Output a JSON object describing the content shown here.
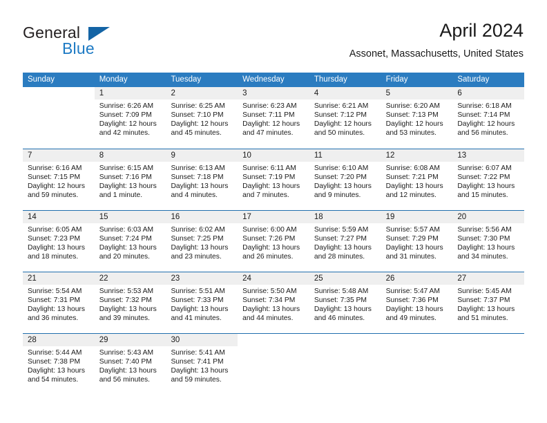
{
  "brand": {
    "name_top": "General",
    "name_bottom": "Blue",
    "accent_color": "#1464a5",
    "blue_text_color": "#1d7ac4",
    "flag_icon": "triangle-flag-icon"
  },
  "header": {
    "title": "April 2024",
    "subtitle": "Assonet, Massachusetts, United States"
  },
  "calendar": {
    "header_bg": "#2b7cc0",
    "header_text_color": "#ffffff",
    "daynum_band_bg": "#efefef",
    "row_divider_color": "#1f6ead",
    "weekday_headers": [
      "Sunday",
      "Monday",
      "Tuesday",
      "Wednesday",
      "Thursday",
      "Friday",
      "Saturday"
    ],
    "weeks": [
      [
        {
          "day": "",
          "sunrise": "",
          "sunset": "",
          "daylight_line1": "",
          "daylight_line2": ""
        },
        {
          "day": "1",
          "sunrise": "Sunrise: 6:26 AM",
          "sunset": "Sunset: 7:09 PM",
          "daylight_line1": "Daylight: 12 hours",
          "daylight_line2": "and 42 minutes."
        },
        {
          "day": "2",
          "sunrise": "Sunrise: 6:25 AM",
          "sunset": "Sunset: 7:10 PM",
          "daylight_line1": "Daylight: 12 hours",
          "daylight_line2": "and 45 minutes."
        },
        {
          "day": "3",
          "sunrise": "Sunrise: 6:23 AM",
          "sunset": "Sunset: 7:11 PM",
          "daylight_line1": "Daylight: 12 hours",
          "daylight_line2": "and 47 minutes."
        },
        {
          "day": "4",
          "sunrise": "Sunrise: 6:21 AM",
          "sunset": "Sunset: 7:12 PM",
          "daylight_line1": "Daylight: 12 hours",
          "daylight_line2": "and 50 minutes."
        },
        {
          "day": "5",
          "sunrise": "Sunrise: 6:20 AM",
          "sunset": "Sunset: 7:13 PM",
          "daylight_line1": "Daylight: 12 hours",
          "daylight_line2": "and 53 minutes."
        },
        {
          "day": "6",
          "sunrise": "Sunrise: 6:18 AM",
          "sunset": "Sunset: 7:14 PM",
          "daylight_line1": "Daylight: 12 hours",
          "daylight_line2": "and 56 minutes."
        }
      ],
      [
        {
          "day": "7",
          "sunrise": "Sunrise: 6:16 AM",
          "sunset": "Sunset: 7:15 PM",
          "daylight_line1": "Daylight: 12 hours",
          "daylight_line2": "and 59 minutes."
        },
        {
          "day": "8",
          "sunrise": "Sunrise: 6:15 AM",
          "sunset": "Sunset: 7:16 PM",
          "daylight_line1": "Daylight: 13 hours",
          "daylight_line2": "and 1 minute."
        },
        {
          "day": "9",
          "sunrise": "Sunrise: 6:13 AM",
          "sunset": "Sunset: 7:18 PM",
          "daylight_line1": "Daylight: 13 hours",
          "daylight_line2": "and 4 minutes."
        },
        {
          "day": "10",
          "sunrise": "Sunrise: 6:11 AM",
          "sunset": "Sunset: 7:19 PM",
          "daylight_line1": "Daylight: 13 hours",
          "daylight_line2": "and 7 minutes."
        },
        {
          "day": "11",
          "sunrise": "Sunrise: 6:10 AM",
          "sunset": "Sunset: 7:20 PM",
          "daylight_line1": "Daylight: 13 hours",
          "daylight_line2": "and 9 minutes."
        },
        {
          "day": "12",
          "sunrise": "Sunrise: 6:08 AM",
          "sunset": "Sunset: 7:21 PM",
          "daylight_line1": "Daylight: 13 hours",
          "daylight_line2": "and 12 minutes."
        },
        {
          "day": "13",
          "sunrise": "Sunrise: 6:07 AM",
          "sunset": "Sunset: 7:22 PM",
          "daylight_line1": "Daylight: 13 hours",
          "daylight_line2": "and 15 minutes."
        }
      ],
      [
        {
          "day": "14",
          "sunrise": "Sunrise: 6:05 AM",
          "sunset": "Sunset: 7:23 PM",
          "daylight_line1": "Daylight: 13 hours",
          "daylight_line2": "and 18 minutes."
        },
        {
          "day": "15",
          "sunrise": "Sunrise: 6:03 AM",
          "sunset": "Sunset: 7:24 PM",
          "daylight_line1": "Daylight: 13 hours",
          "daylight_line2": "and 20 minutes."
        },
        {
          "day": "16",
          "sunrise": "Sunrise: 6:02 AM",
          "sunset": "Sunset: 7:25 PM",
          "daylight_line1": "Daylight: 13 hours",
          "daylight_line2": "and 23 minutes."
        },
        {
          "day": "17",
          "sunrise": "Sunrise: 6:00 AM",
          "sunset": "Sunset: 7:26 PM",
          "daylight_line1": "Daylight: 13 hours",
          "daylight_line2": "and 26 minutes."
        },
        {
          "day": "18",
          "sunrise": "Sunrise: 5:59 AM",
          "sunset": "Sunset: 7:27 PM",
          "daylight_line1": "Daylight: 13 hours",
          "daylight_line2": "and 28 minutes."
        },
        {
          "day": "19",
          "sunrise": "Sunrise: 5:57 AM",
          "sunset": "Sunset: 7:29 PM",
          "daylight_line1": "Daylight: 13 hours",
          "daylight_line2": "and 31 minutes."
        },
        {
          "day": "20",
          "sunrise": "Sunrise: 5:56 AM",
          "sunset": "Sunset: 7:30 PM",
          "daylight_line1": "Daylight: 13 hours",
          "daylight_line2": "and 34 minutes."
        }
      ],
      [
        {
          "day": "21",
          "sunrise": "Sunrise: 5:54 AM",
          "sunset": "Sunset: 7:31 PM",
          "daylight_line1": "Daylight: 13 hours",
          "daylight_line2": "and 36 minutes."
        },
        {
          "day": "22",
          "sunrise": "Sunrise: 5:53 AM",
          "sunset": "Sunset: 7:32 PM",
          "daylight_line1": "Daylight: 13 hours",
          "daylight_line2": "and 39 minutes."
        },
        {
          "day": "23",
          "sunrise": "Sunrise: 5:51 AM",
          "sunset": "Sunset: 7:33 PM",
          "daylight_line1": "Daylight: 13 hours",
          "daylight_line2": "and 41 minutes."
        },
        {
          "day": "24",
          "sunrise": "Sunrise: 5:50 AM",
          "sunset": "Sunset: 7:34 PM",
          "daylight_line1": "Daylight: 13 hours",
          "daylight_line2": "and 44 minutes."
        },
        {
          "day": "25",
          "sunrise": "Sunrise: 5:48 AM",
          "sunset": "Sunset: 7:35 PM",
          "daylight_line1": "Daylight: 13 hours",
          "daylight_line2": "and 46 minutes."
        },
        {
          "day": "26",
          "sunrise": "Sunrise: 5:47 AM",
          "sunset": "Sunset: 7:36 PM",
          "daylight_line1": "Daylight: 13 hours",
          "daylight_line2": "and 49 minutes."
        },
        {
          "day": "27",
          "sunrise": "Sunrise: 5:45 AM",
          "sunset": "Sunset: 7:37 PM",
          "daylight_line1": "Daylight: 13 hours",
          "daylight_line2": "and 51 minutes."
        }
      ],
      [
        {
          "day": "28",
          "sunrise": "Sunrise: 5:44 AM",
          "sunset": "Sunset: 7:38 PM",
          "daylight_line1": "Daylight: 13 hours",
          "daylight_line2": "and 54 minutes."
        },
        {
          "day": "29",
          "sunrise": "Sunrise: 5:43 AM",
          "sunset": "Sunset: 7:40 PM",
          "daylight_line1": "Daylight: 13 hours",
          "daylight_line2": "and 56 minutes."
        },
        {
          "day": "30",
          "sunrise": "Sunrise: 5:41 AM",
          "sunset": "Sunset: 7:41 PM",
          "daylight_line1": "Daylight: 13 hours",
          "daylight_line2": "and 59 minutes."
        },
        {
          "day": "",
          "sunrise": "",
          "sunset": "",
          "daylight_line1": "",
          "daylight_line2": ""
        },
        {
          "day": "",
          "sunrise": "",
          "sunset": "",
          "daylight_line1": "",
          "daylight_line2": ""
        },
        {
          "day": "",
          "sunrise": "",
          "sunset": "",
          "daylight_line1": "",
          "daylight_line2": ""
        },
        {
          "day": "",
          "sunrise": "",
          "sunset": "",
          "daylight_line1": "",
          "daylight_line2": ""
        }
      ]
    ]
  }
}
